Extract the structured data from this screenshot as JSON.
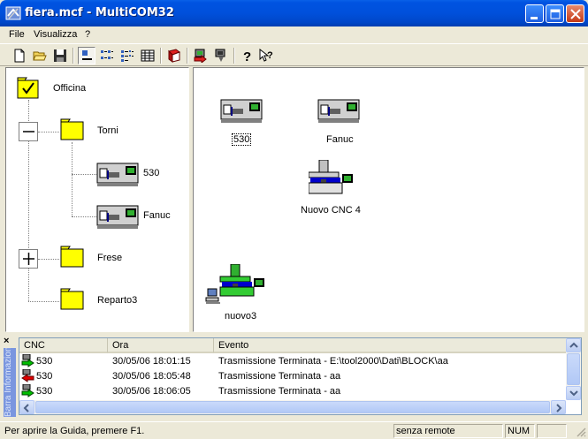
{
  "window": {
    "title": "fiera.mcf - MultiCOM32"
  },
  "menu": {
    "items": [
      "File",
      "Visualizza",
      "?"
    ]
  },
  "toolbar": {
    "buttons": [
      "new-icon",
      "open-icon",
      "save-icon",
      "large-icons-icon",
      "small-icons-icon",
      "list-icon",
      "details-icon",
      "book-icon",
      "transmit-icon",
      "receive-icon",
      "help-icon",
      "context-help-icon"
    ]
  },
  "tree": {
    "root": "Officina",
    "groups": [
      {
        "label": "Torni",
        "expanded": true,
        "children": [
          "530",
          "Fanuc"
        ]
      },
      {
        "label": "Frese",
        "expanded": false,
        "children": []
      },
      {
        "label": "Reparto3",
        "expanded": false,
        "children": []
      }
    ]
  },
  "main": {
    "icons": [
      {
        "label": "530",
        "selected": true,
        "kind": "lathe"
      },
      {
        "label": "Fanuc",
        "selected": false,
        "kind": "lathe"
      },
      {
        "label": "Nuovo CNC 4",
        "selected": false,
        "kind": "mill"
      },
      {
        "label": "nuovo3",
        "selected": false,
        "kind": "mill-green"
      }
    ]
  },
  "info_bar": {
    "side_label": "Barra Informazioni",
    "close_label": "×",
    "columns": [
      "CNC",
      "Ora",
      "Evento"
    ],
    "rows": [
      {
        "cnc": "530",
        "ora": "30/05/06 18:01:15",
        "evento": "Trasmissione Terminata - E:\\tool2000\\Dati\\BLOCK\\aa",
        "direction": "send"
      },
      {
        "cnc": "530",
        "ora": "30/05/06 18:05:48",
        "evento": "Trasmissione Terminata - aa",
        "direction": "receive"
      },
      {
        "cnc": "530",
        "ora": "30/05/06 18:06:05",
        "evento": "Trasmissione Terminata - aa",
        "direction": "send"
      }
    ]
  },
  "statusbar": {
    "message": "Per aprire la Guida, premere F1.",
    "remote": "senza remote",
    "num": "NUM"
  },
  "colors": {
    "titlebar": "#0053E1",
    "folder": "#FFFF00",
    "machine_green": "#33CC33",
    "machine_blue": "#0000CC",
    "arrow_green": "#00C000",
    "arrow_red": "#E00000"
  }
}
